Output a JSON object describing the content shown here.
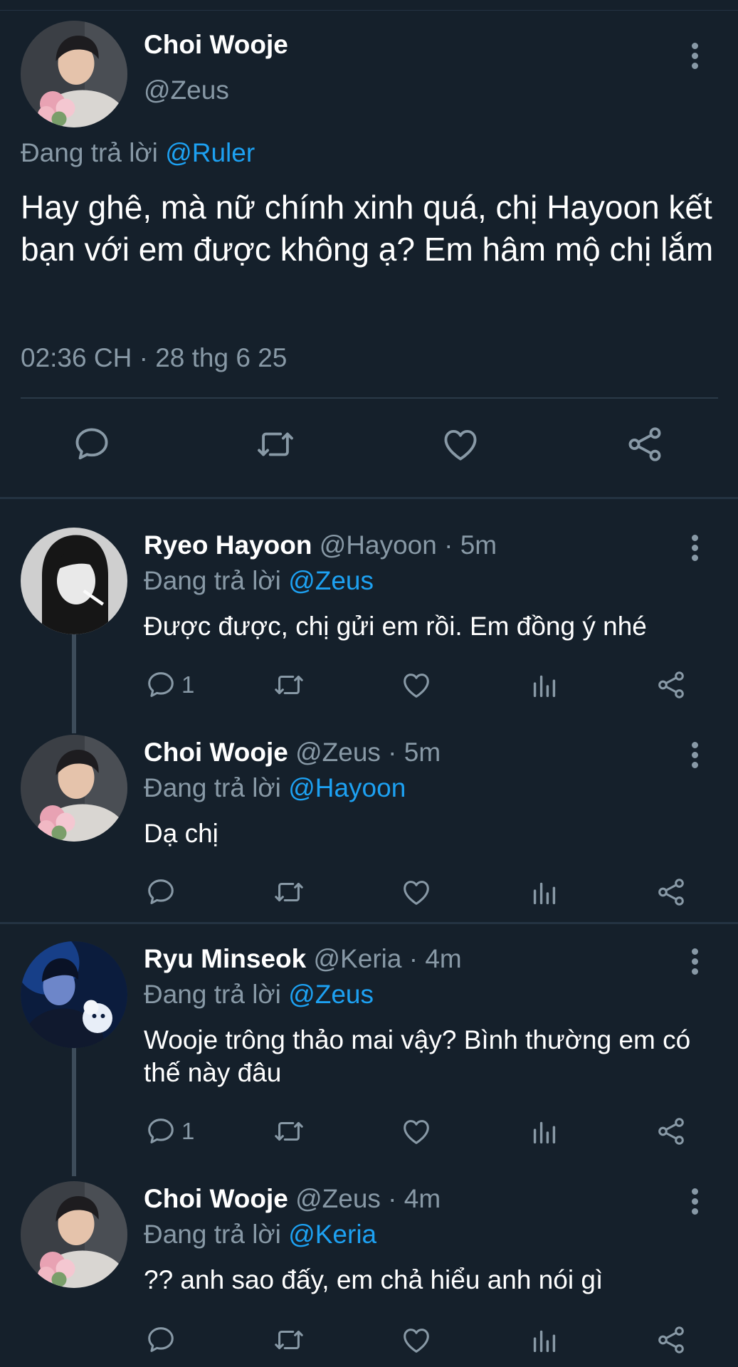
{
  "main_tweet": {
    "name": "Choi Wooje",
    "handle": "@Zeus",
    "replying_prefix": "Đang trả lời",
    "replying_to": "@Ruler",
    "text": "Hay ghê, mà nữ chính xinh quá, chị Hayoon kết bạn với em được không ạ? Em hâm mộ chị lắm",
    "timestamp": "02:36 CH · 28 thg 6 25",
    "actions": [
      "reply-icon",
      "retweet-icon",
      "like-icon",
      "share-icon"
    ]
  },
  "replies": [
    {
      "name": "Ryeo Hayoon",
      "handle": "@Hayoon · 5m",
      "replying_prefix": "Đang trả lời",
      "replying_to": "@Zeus",
      "text": "Được được, chị gửi em rồi. Em đồng ý nhé",
      "reply_count": "1",
      "avatar": "dark-hair-girl"
    },
    {
      "name": "Choi Wooje",
      "handle": "@Zeus · 5m",
      "replying_prefix": "Đang trả lời",
      "replying_to": "@Hayoon",
      "text": "Dạ chị",
      "reply_count": "",
      "avatar": "boy-with-flowers"
    },
    {
      "name": "Ryu Minseok",
      "handle": "@Keria · 4m",
      "replying_prefix": "Đang trả lời",
      "replying_to": "@Zeus",
      "text": "Wooje trông thảo mai vậy? Bình thường em có thế này đâu",
      "reply_count": "1",
      "avatar": "boy-blue-light"
    },
    {
      "name": "Choi Wooje",
      "handle": "@Zeus · 4m",
      "replying_prefix": "Đang trả lời",
      "replying_to": "@Keria",
      "text": "?? anh sao đấy, em chả hiểu anh nói gì",
      "reply_count": "",
      "avatar": "boy-with-flowers"
    }
  ],
  "colors": {
    "background": "#15202b",
    "secondary_text": "#8899a6",
    "mention": "#1da1f2",
    "divider": "#243342"
  }
}
